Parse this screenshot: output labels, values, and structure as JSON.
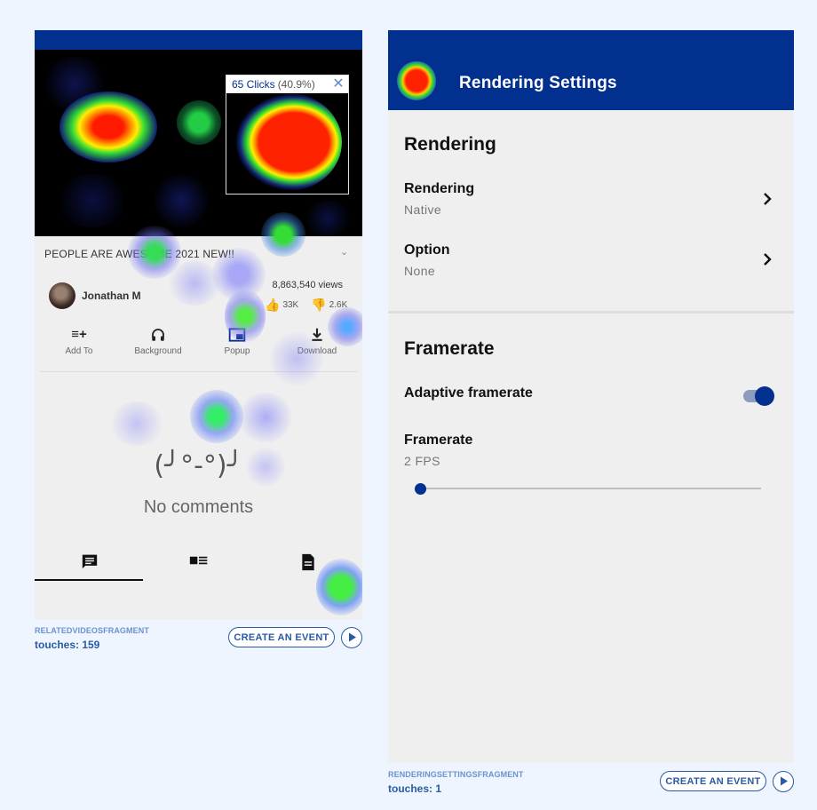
{
  "left_screen": {
    "popup": {
      "clicks": "65 Clicks",
      "percent": "(40.9%)",
      "close": "✕"
    },
    "video_title": "PEOPLE ARE AWESOME 2021 NEW!!",
    "channel": "Jonathan M",
    "views": "8,863,540 views",
    "likes": "33K",
    "dislikes": "2.6K",
    "actions": [
      {
        "label": "Add To",
        "icon": "playlist-add-icon"
      },
      {
        "label": "Background",
        "icon": "headphones-icon"
      },
      {
        "label": "Popup",
        "icon": "picture-in-picture-icon"
      },
      {
        "label": "Download",
        "icon": "download-icon"
      }
    ],
    "empty_face": "(╯°-°)╯",
    "empty_text": "No comments",
    "tabs": [
      {
        "icon": "comment-icon",
        "selected": true
      },
      {
        "icon": "related-videos-icon",
        "selected": false
      },
      {
        "icon": "description-icon",
        "selected": false
      }
    ],
    "footer": {
      "fragment": "RELATEDVIDEOSFRAGMENT",
      "touches": "touches: 159",
      "button": "CREATE AN EVENT"
    }
  },
  "right_screen": {
    "header_title": "Rendering Settings",
    "section_rendering": "Rendering",
    "rows": [
      {
        "title": "Rendering",
        "value": "Native"
      },
      {
        "title": "Option",
        "value": "None"
      }
    ],
    "section_framerate": "Framerate",
    "adaptive_label": "Adaptive framerate",
    "adaptive_on": true,
    "framerate_label": "Framerate",
    "framerate_value": "2 FPS",
    "footer": {
      "fragment": "RENDERINGSETTINGSFRAGMENT",
      "touches": "touches: 1",
      "button": "CREATE AN EVENT"
    }
  },
  "colors": {
    "primary": "#02308f",
    "accent": "#2a5aa5",
    "fragment_label": "#6a93cf"
  }
}
